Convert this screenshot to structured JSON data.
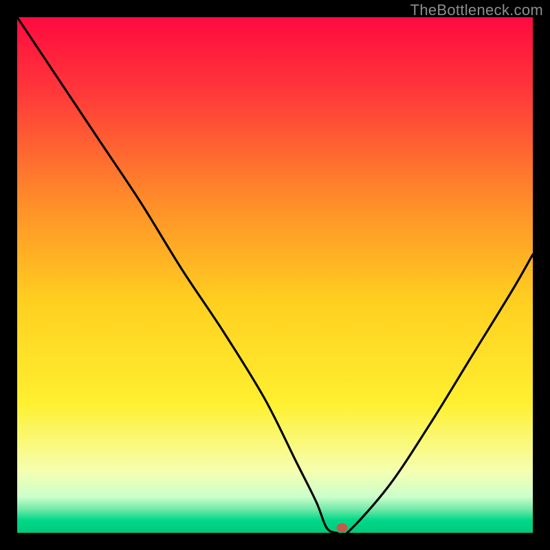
{
  "watermark": "TheBottleneck.com",
  "chart_data": {
    "type": "line",
    "title": "",
    "xlabel": "",
    "ylabel": "",
    "xlim": [
      0,
      100
    ],
    "ylim": [
      0,
      100
    ],
    "series": [
      {
        "name": "curve",
        "x": [
          0,
          8,
          16,
          24,
          32,
          40,
          48,
          54,
          58,
          60,
          62,
          64,
          72,
          80,
          88,
          96,
          100
        ],
        "values": [
          100,
          88,
          76,
          64,
          51,
          39,
          26,
          14,
          6,
          1,
          0,
          0,
          9,
          21,
          34,
          47,
          54
        ]
      }
    ],
    "marker": {
      "x": 63,
      "y": 1,
      "color": "#c45a4a"
    },
    "gradient_stops": [
      {
        "offset": 0.0,
        "color": "#ff0a3f"
      },
      {
        "offset": 0.15,
        "color": "#ff3a3a"
      },
      {
        "offset": 0.35,
        "color": "#ff8a2a"
      },
      {
        "offset": 0.55,
        "color": "#ffcf20"
      },
      {
        "offset": 0.75,
        "color": "#fff030"
      },
      {
        "offset": 0.88,
        "color": "#f5ffb0"
      },
      {
        "offset": 0.93,
        "color": "#ccffcc"
      },
      {
        "offset": 0.955,
        "color": "#70e8a8"
      },
      {
        "offset": 0.975,
        "color": "#00d989"
      },
      {
        "offset": 1.0,
        "color": "#00c97c"
      }
    ]
  }
}
